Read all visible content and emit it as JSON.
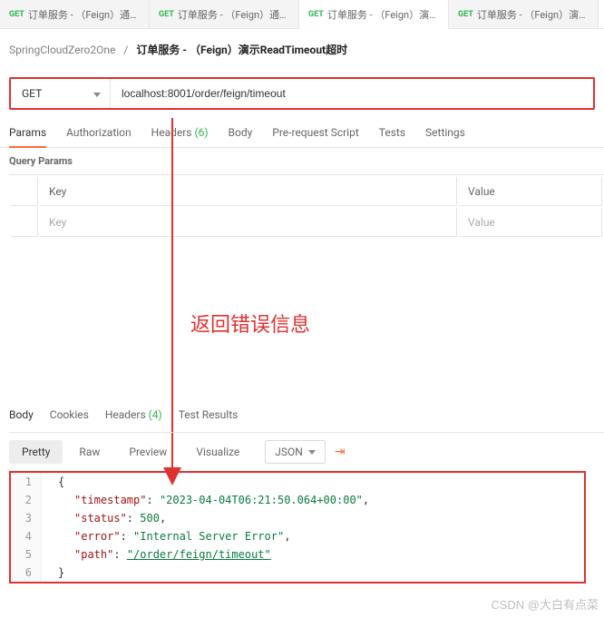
{
  "tabs": [
    {
      "method": "GET",
      "label": "订单服务 - （Feign）通过"
    },
    {
      "method": "GET",
      "label": "订单服务 - （Feign）通过"
    },
    {
      "method": "GET",
      "label": "订单服务 - （Feign）演示"
    },
    {
      "method": "GET",
      "label": "订单服务 - （Feign）演示"
    }
  ],
  "breadcrumb": {
    "project": "SpringCloudZero2One",
    "sep": "/",
    "current": "订单服务 - （Feign）演示ReadTimeout超时"
  },
  "request": {
    "method": "GET",
    "url": "localhost:8001/order/feign/timeout"
  },
  "req_tabs": {
    "params": "Params",
    "auth": "Authorization",
    "headers": "Headers",
    "headers_count": "(6)",
    "body": "Body",
    "pre": "Pre-request Script",
    "tests": "Tests",
    "settings": "Settings"
  },
  "query_params_label": "Query Params",
  "params_header": {
    "key": "Key",
    "value": "Value"
  },
  "params_placeholder": {
    "key": "Key",
    "value": "Value"
  },
  "annotation": "返回错误信息",
  "resp_tabs": {
    "body": "Body",
    "cookies": "Cookies",
    "headers": "Headers",
    "headers_count": "(4)",
    "tests": "Test Results"
  },
  "resp_views": {
    "pretty": "Pretty",
    "raw": "Raw",
    "preview": "Preview",
    "visualize": "Visualize"
  },
  "resp_format": "JSON",
  "json_body": {
    "l1": "{",
    "l2_k": "\"timestamp\"",
    "l2_v": "\"2023-04-04T06:21:50.064+00:00\"",
    "l3_k": "\"status\"",
    "l3_v": "500",
    "l4_k": "\"error\"",
    "l4_v": "\"Internal Server Error\"",
    "l5_k": "\"path\"",
    "l5_v": "\"/order/feign/timeout\"",
    "l6": "}",
    "colon": ": ",
    "comma": ","
  },
  "line_no": {
    "1": "1",
    "2": "2",
    "3": "3",
    "4": "4",
    "5": "5",
    "6": "6"
  },
  "watermark": "CSDN @大白有点菜"
}
